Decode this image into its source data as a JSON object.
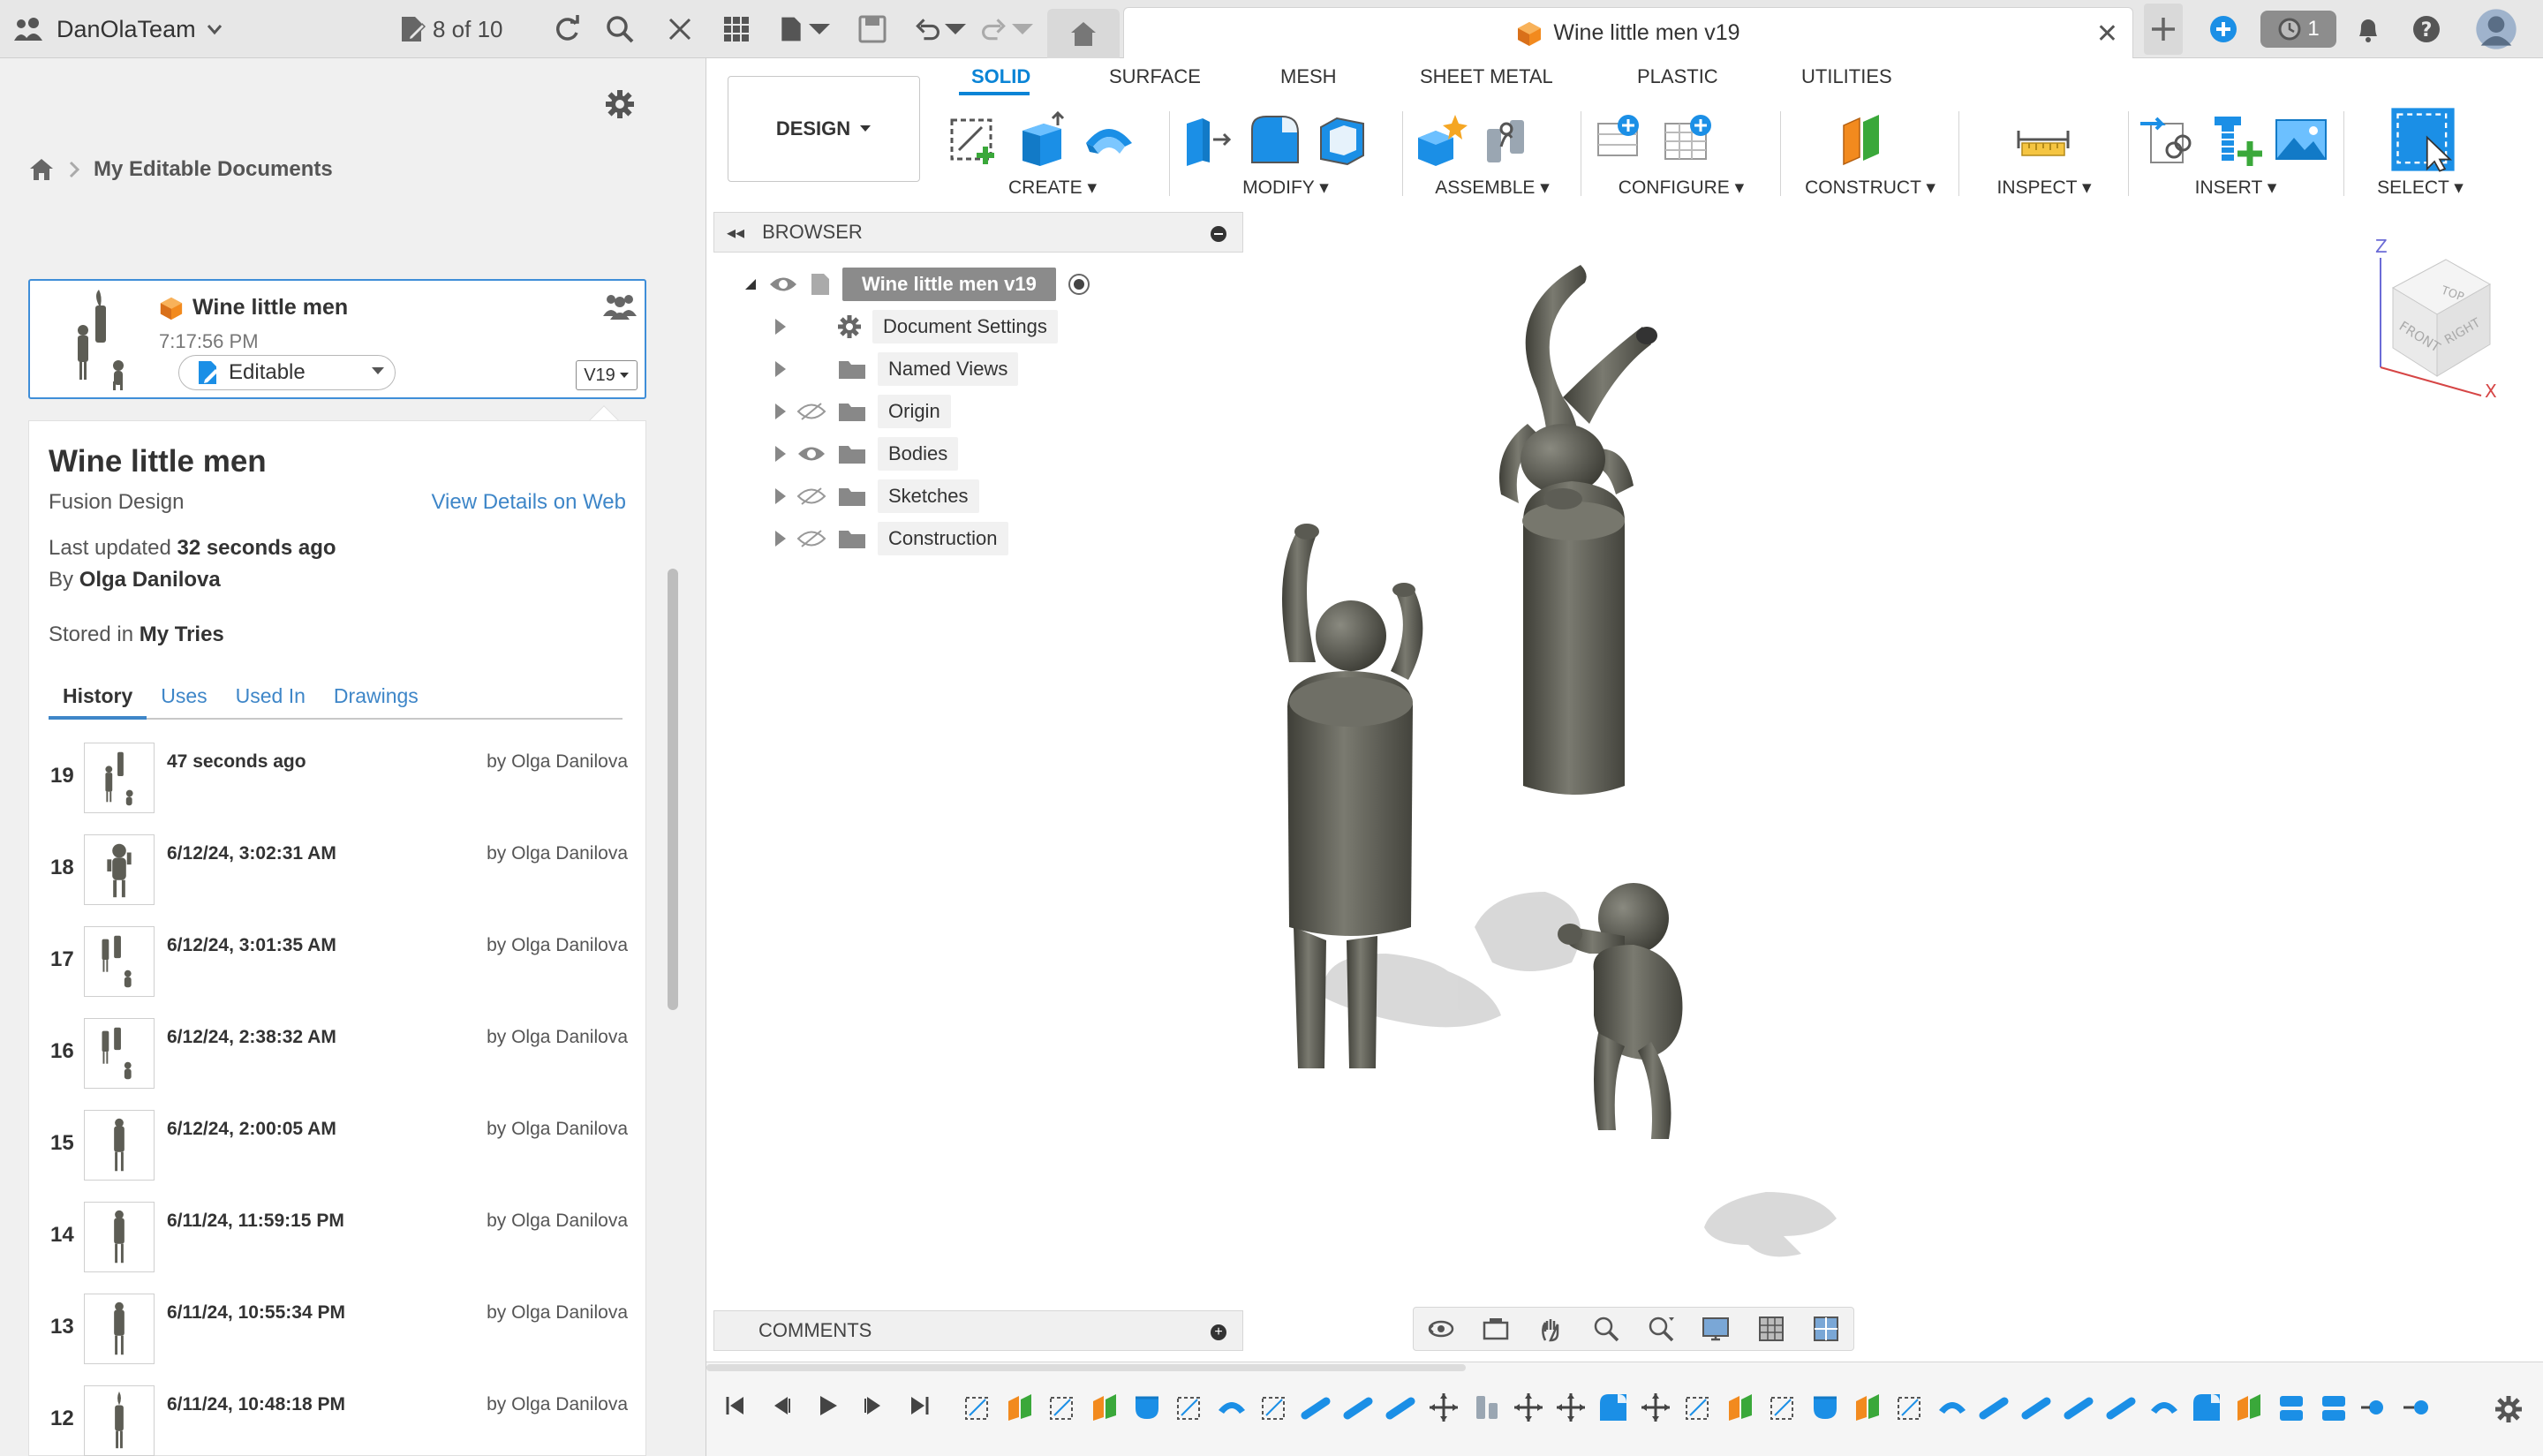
{
  "appbar": {
    "team_name": "DanOlaTeam",
    "file_counter": "8 of 10",
    "document_tab_title": "Wine little men v19",
    "jobs_count": "1"
  },
  "data_panel": {
    "breadcrumb": "My Editable Documents",
    "card": {
      "title": "Wine little men",
      "time": "7:17:56 PM",
      "status": "Editable",
      "version": "V19"
    },
    "details": {
      "title": "Wine little men",
      "app": "Fusion Design",
      "view_web": "View Details on Web",
      "last_updated_prefix": "Last updated",
      "last_updated_value": "32 seconds ago",
      "by_prefix": "By",
      "by_value": "Olga Danilova",
      "stored_prefix": "Stored in",
      "stored_value": "My Tries",
      "tabs": [
        "History",
        "Uses",
        "Used In",
        "Drawings"
      ]
    },
    "history": [
      {
        "version": "19",
        "time": "47 seconds ago",
        "by": "by Olga Danilova"
      },
      {
        "version": "18",
        "time": "6/12/24, 3:02:31 AM",
        "by": "by Olga Danilova"
      },
      {
        "version": "17",
        "time": "6/12/24, 3:01:35 AM",
        "by": "by Olga Danilova"
      },
      {
        "version": "16",
        "time": "6/12/24, 2:38:32 AM",
        "by": "by Olga Danilova"
      },
      {
        "version": "15",
        "time": "6/12/24, 2:00:05 AM",
        "by": "by Olga Danilova"
      },
      {
        "version": "14",
        "time": "6/11/24, 11:59:15 PM",
        "by": "by Olga Danilova"
      },
      {
        "version": "13",
        "time": "6/11/24, 10:55:34 PM",
        "by": "by Olga Danilova"
      },
      {
        "version": "12",
        "time": "6/11/24, 10:48:18 PM",
        "by": "by Olga Danilova"
      }
    ]
  },
  "toolbar": {
    "workspace": "DESIGN",
    "tabs": [
      "SOLID",
      "SURFACE",
      "MESH",
      "SHEET METAL",
      "PLASTIC",
      "UTILITIES"
    ],
    "groups": {
      "create": "CREATE",
      "modify": "MODIFY",
      "assemble": "ASSEMBLE",
      "configure": "CONFIGURE",
      "construct": "CONSTRUCT",
      "inspect": "INSPECT",
      "insert": "INSERT",
      "select": "SELECT"
    }
  },
  "browser": {
    "header": "BROWSER",
    "root": "Wine little men v19",
    "nodes": [
      "Document Settings",
      "Named Views",
      "Origin",
      "Bodies",
      "Sketches",
      "Construction"
    ]
  },
  "comments": {
    "label": "COMMENTS"
  },
  "viewcube": {
    "top": "TOP",
    "front": "FRONT",
    "right": "RIGHT",
    "axis_z": "Z",
    "axis_x": "X"
  },
  "colors": {
    "accent": "#0a84d6",
    "link": "#3e86c8",
    "model": "#5d5d55",
    "fusion_orange": "#f28a1e"
  }
}
